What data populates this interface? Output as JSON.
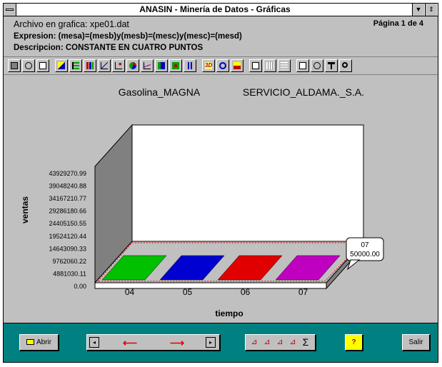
{
  "window": {
    "title": "ANASIN - Minería de Datos - Gráficas",
    "menu_icon": "system-menu-icon",
    "buttons": [
      "▼",
      "⇕"
    ]
  },
  "header": {
    "archivo": "Archivo en grafica: xpe01.dat",
    "expresion": "Expresion: (mesa)=(mesb)y(mesb)=(mesc)y(mesc)=(mesd)",
    "descripcion": "Descripcion: CONSTANTE EN CUATRO PUNTOS",
    "pagina": "Página 1 de 4"
  },
  "toolbar": {
    "icons": [
      "camera-icon",
      "scissors-icon",
      "printer-icon",
      "area-chart-icon",
      "horizontal-bar-icon",
      "bar-chart-icon",
      "line-chart-icon",
      "scatter-chart-icon",
      "pie-chart-icon",
      "area-line-icon",
      "combo-chart-icon",
      "dots-chart-icon",
      "hilo-chart-icon",
      "3d-icon",
      "rotate-icon",
      "stack-icon",
      "single-page-icon",
      "grid-icon",
      "lines-icon",
      "label-icon",
      "zoom-font-icon",
      "tools-icon",
      "magnify-icon"
    ],
    "three_d_label": "3D"
  },
  "chart_data": {
    "type": "bar",
    "title_left": "Gasolina_MAGNA",
    "title_right": "SERVICIO_ALDAMA._S.A.",
    "xlabel": "tiempo",
    "ylabel": "ventas",
    "categories": [
      "04",
      "05",
      "06",
      "07"
    ],
    "values": [
      50000.0,
      50000.0,
      50000.0,
      50000.0
    ],
    "bar_colors": [
      "#00c000",
      "#0000d0",
      "#e00000",
      "#c000c0"
    ],
    "yticks": [
      "43929270.99",
      "39048240.88",
      "34167210.77",
      "29286180.66",
      "24405150.55",
      "19524120.44",
      "14643090.33",
      "9762060.22",
      "4881030.11",
      "0.00"
    ],
    "ylim": [
      0,
      43929270.99
    ],
    "tooltip": {
      "category": "07",
      "value": "50000.00"
    },
    "three_d": true
  },
  "bottombar": {
    "abrir_label": "Abrir",
    "salir_label": "Salir",
    "sigma": "Σ",
    "help": "?"
  }
}
